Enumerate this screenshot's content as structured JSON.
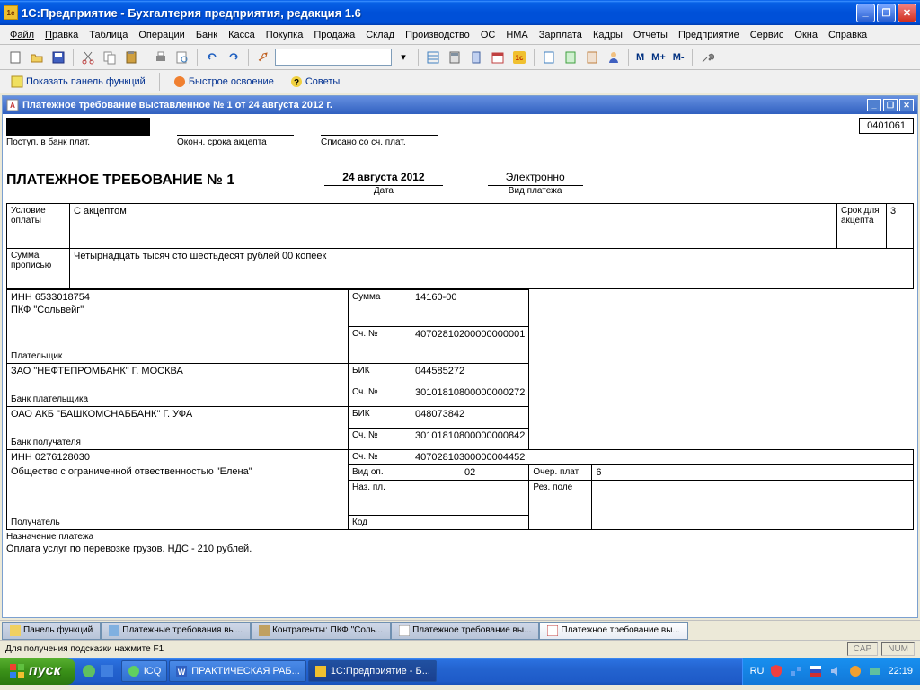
{
  "window": {
    "title": "1С:Предприятие - Бухгалтерия предприятия, редакция 1.6"
  },
  "menu": {
    "items": [
      "Файл",
      "Правка",
      "Таблица",
      "Операции",
      "Банк",
      "Касса",
      "Покупка",
      "Продажа",
      "Склад",
      "Производство",
      "ОС",
      "НМА",
      "Зарплата",
      "Кадры",
      "Отчеты",
      "Предприятие",
      "Сервис",
      "Окна",
      "Справка"
    ]
  },
  "toolbar2": {
    "show_panel": "Показать панель функций",
    "quick_start": "Быстрое освоение",
    "tips": "Советы"
  },
  "doc": {
    "title": "Платежное требование выставленное № 1 от 24 августа 2012 г.",
    "code": "0401061",
    "field_bank_receipt": "Поступ. в банк плат.",
    "field_accept_end": "Оконч. срока акцепта",
    "field_written_off": "Списано со сч. плат.",
    "form_title": "ПЛАТЕЖНОЕ ТРЕБОВАНИЕ № 1",
    "date": "24 августа 2012",
    "date_lbl": "Дата",
    "payment_type": "Электронно",
    "payment_type_lbl": "Вид платежа",
    "condition_lbl": "Условие оплаты",
    "condition_val": "С акцептом",
    "accept_term_lbl": "Срок для акцепта",
    "accept_term_val": "3",
    "sum_words_lbl": "Сумма прописью",
    "sum_words_val": "Четырнадцать тысяч сто шестьдесят рублей 00 копеек",
    "inn1": "ИНН 6533018754",
    "payer_name": "ПКФ \"Сольвейг\"",
    "sum_lbl": "Сумма",
    "sum_val": "14160-00",
    "acct_lbl": "Сч. №",
    "payer_acct": "40702810200000000001",
    "payer_lbl": "Плательщик",
    "bank1": "ЗАО \"НЕФТЕПРОМБАНК\" Г. МОСКВА",
    "bik_lbl": "БИК",
    "bik1": "044585272",
    "bank1_acct": "30101810800000000272",
    "payer_bank_lbl": "Банк плательщика",
    "bank2": "ОАО АКБ \"БАШКОМСНАББАНК\" Г. УФА",
    "bik2": "048073842",
    "bank2_acct": "30101810800000000842",
    "recv_bank_lbl": "Банк получателя",
    "inn2": "ИНН 0276128030",
    "recv_name": "Общество с ограниченной отвественностью \"Елена\"",
    "recv_acct": "40702810300000004452",
    "vid_op_lbl": "Вид оп.",
    "vid_op_val": "02",
    "order_lbl": "Очер. плат.",
    "order_val": "6",
    "naz_pl_lbl": "Наз. пл.",
    "rez_lbl": "Рез. поле",
    "kod_lbl": "Код",
    "recv_lbl": "Получатель",
    "purpose_lbl": "Назначение платежа",
    "purpose_val": "Оплата услуг по перевозке грузов. НДС - 210 рублей."
  },
  "tabs": {
    "t1": "Панель функций",
    "t2": "Платежные требования вы...",
    "t3": "Контрагенты: ПКФ \"Соль...",
    "t4": "Платежное требование вы...",
    "t5": "Платежное требование вы..."
  },
  "statusbar": {
    "hint": "Для получения подсказки нажмите F1",
    "cap": "CAP",
    "num": "NUM"
  },
  "taskbar": {
    "start": "пуск",
    "icq": "ICQ",
    "word": "ПРАКТИЧЕСКАЯ РАБ...",
    "app": "1С:Предприятие - Б...",
    "lang": "RU",
    "time": "22:19"
  }
}
